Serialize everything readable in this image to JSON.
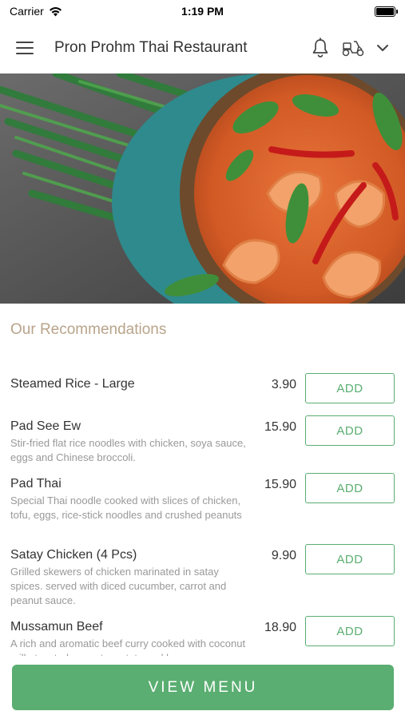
{
  "status_bar": {
    "carrier": "Carrier",
    "time": "1:19 PM"
  },
  "header": {
    "title": "Pron Prohm Thai Restaurant",
    "icons": [
      "menu-icon",
      "bell-icon",
      "scooter-icon",
      "chevron-down-icon"
    ]
  },
  "hero": {
    "description_icon": "red-curry-shrimp-photo"
  },
  "section": {
    "title": "Our Recommendations"
  },
  "menu_items": [
    {
      "name": "Steamed Rice - Large",
      "description": "",
      "price": "3.90",
      "add_label": "ADD"
    },
    {
      "name": "Pad See Ew",
      "description": "Stir-fried flat rice noodles with chicken, soya sauce, eggs and Chinese broccoli.",
      "price": "15.90",
      "add_label": "ADD"
    },
    {
      "name": "Pad Thai",
      "description": "Special Thai noodle cooked with slices of chicken, tofu, eggs, rice-stick noodles and crushed peanuts",
      "price": "15.90",
      "add_label": "ADD"
    },
    {
      "name": "Satay Chicken (4 Pcs)",
      "description": "Grilled skewers of chicken marinated in satay spices. served with diced cucumber, carrot and peanut sauce.",
      "price": "9.90",
      "add_label": "ADD"
    },
    {
      "name": "Mussamun Beef",
      "description": "A rich and aromatic beef curry cooked with coconut milk, toasted peanuts, potato and bay",
      "price": "18.90",
      "add_label": "ADD"
    }
  ],
  "footer": {
    "view_menu_label": "VIEW MENU"
  },
  "colors": {
    "accent_green": "#5aae71",
    "section_title": "#b9a48a"
  }
}
